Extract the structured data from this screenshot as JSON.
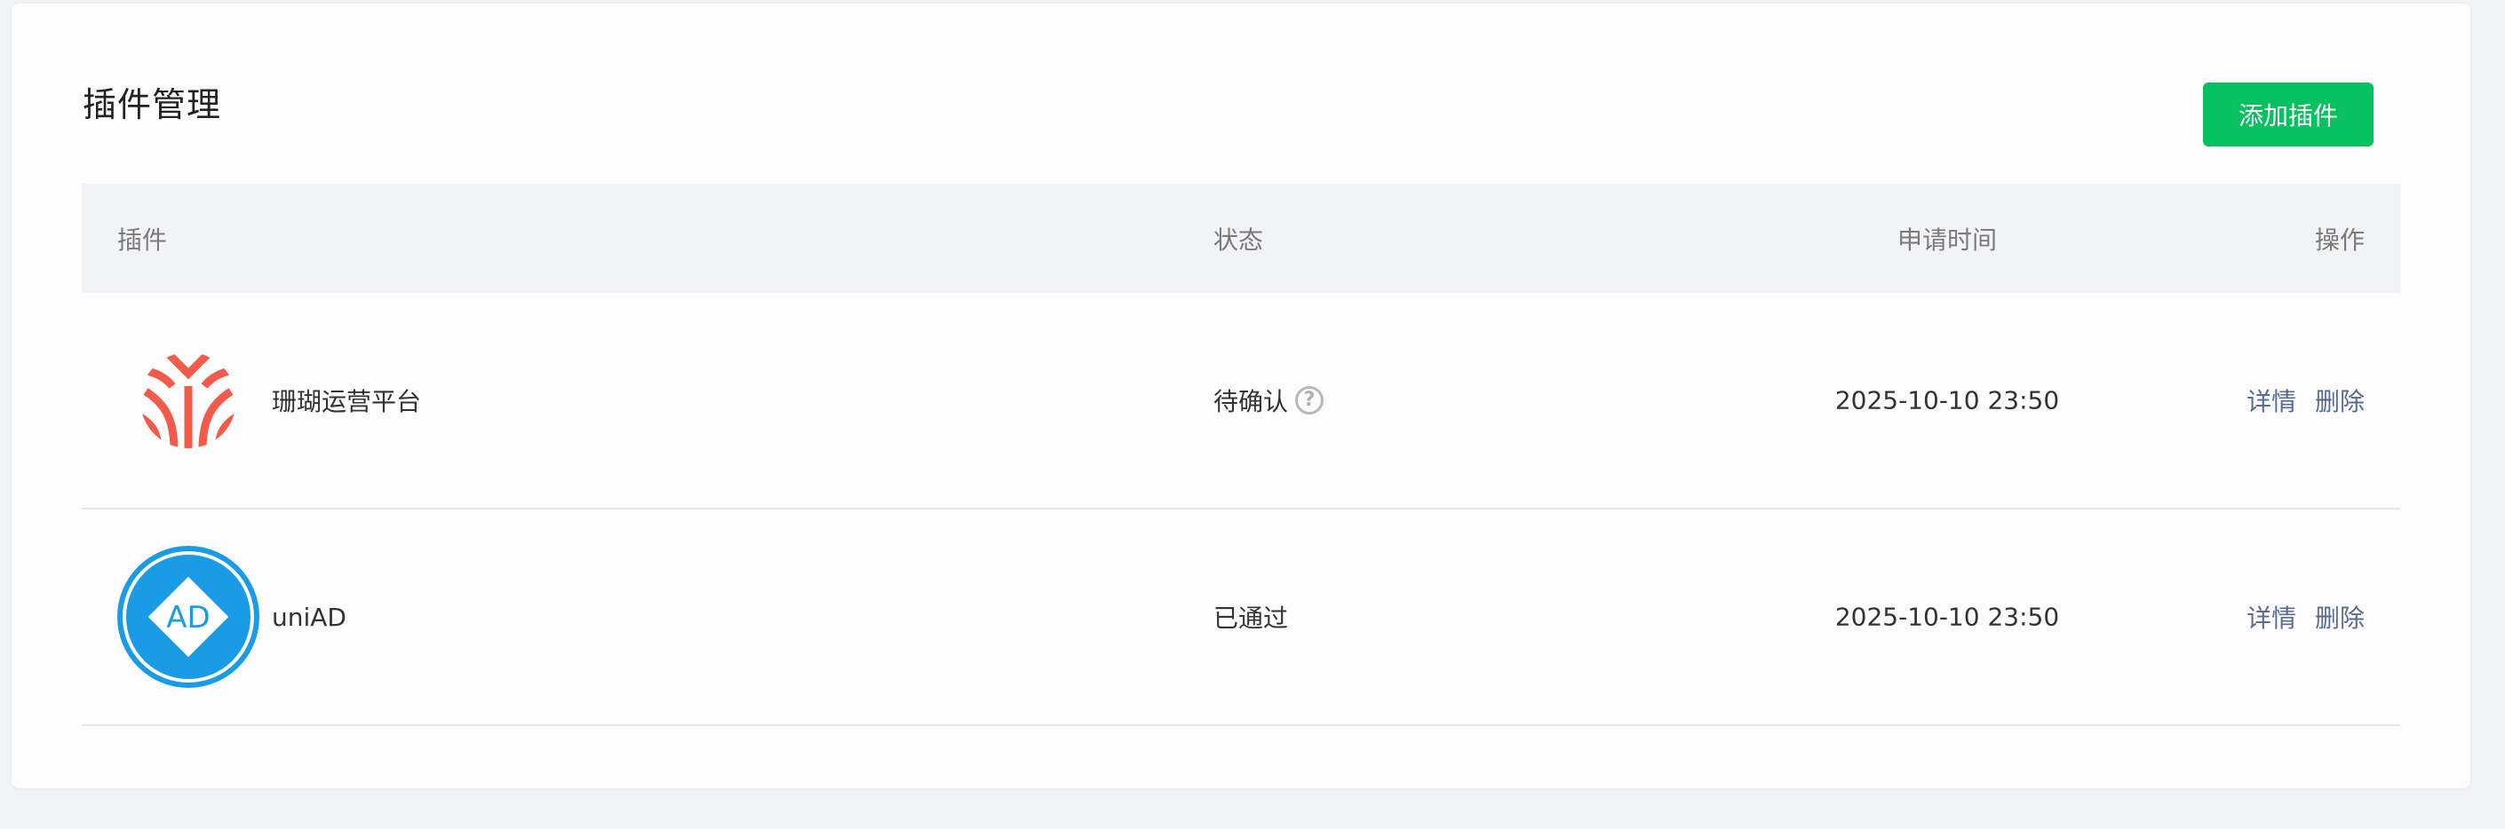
{
  "page": {
    "title": "插件管理",
    "add_button_label": "添加插件"
  },
  "table": {
    "headers": {
      "plugin": "插件",
      "status": "状态",
      "time": "申请时间",
      "actions": "操作"
    },
    "rows": [
      {
        "name": "珊瑚运营平台",
        "icon": "coral-logo-icon",
        "status": "待确认",
        "status_help_icon": "question-circle-icon",
        "time": "2025-10-10 23:50",
        "detail_label": "详情",
        "delete_label": "删除"
      },
      {
        "name": "uniAD",
        "icon": "uniad-logo-icon",
        "logo_text": "AD",
        "status": "已通过",
        "time": "2025-10-10 23:50",
        "detail_label": "详情",
        "delete_label": "删除"
      }
    ]
  },
  "colors": {
    "accent_green": "#07c160",
    "link_blue": "#576b95",
    "coral_red": "#f25a4a",
    "uniad_blue": "#1a9be6"
  }
}
